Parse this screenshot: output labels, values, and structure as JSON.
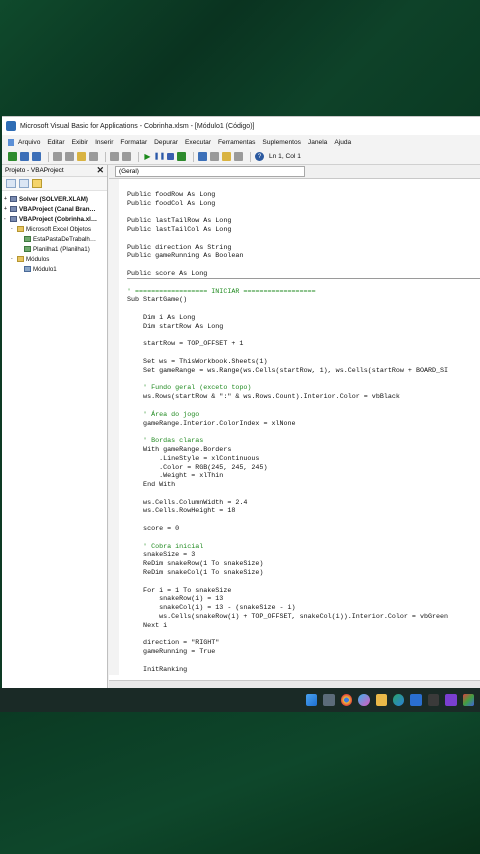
{
  "window": {
    "title": "Microsoft Visual Basic for Applications - Cobrinha.xlsm - [Módulo1 (Código)]"
  },
  "menu": [
    "Arquivo",
    "Editar",
    "Exibir",
    "Inserir",
    "Formatar",
    "Depurar",
    "Executar",
    "Ferramentas",
    "Suplementos",
    "Janela",
    "Ajuda"
  ],
  "toolbar": {
    "position": "Ln 1, Col 1"
  },
  "project_pane": {
    "title": "Projeto - VBAProject",
    "close_glyph": "✕",
    "tree": [
      {
        "label": "Solver (SOLVER.XLAM)",
        "level": 0,
        "icon": "proj",
        "bold": true,
        "twisty": "+"
      },
      {
        "label": "VBAProject (Canal Bran…",
        "level": 0,
        "icon": "proj",
        "bold": true,
        "twisty": "+"
      },
      {
        "label": "VBAProject (Cobrinha.xl…",
        "level": 0,
        "icon": "proj",
        "bold": true,
        "twisty": "-"
      },
      {
        "label": "Microsoft Excel Objetos",
        "level": 1,
        "icon": "folder",
        "bold": false,
        "twisty": "-"
      },
      {
        "label": "EstaPastaDeTrabalh…",
        "level": 2,
        "icon": "sheet",
        "bold": false,
        "twisty": ""
      },
      {
        "label": "Planilha1 (Planilha1)",
        "level": 2,
        "icon": "sheet",
        "bold": false,
        "twisty": ""
      },
      {
        "label": "Módulos",
        "level": 1,
        "icon": "folder",
        "bold": false,
        "twisty": "-"
      },
      {
        "label": "Módulo1",
        "level": 2,
        "icon": "module",
        "bold": false,
        "twisty": ""
      }
    ]
  },
  "code_pane": {
    "object_combo": "(Geral)",
    "lines": [
      {
        "t": "",
        "k": ""
      },
      {
        "t": "Public foodRow As Long",
        "k": ""
      },
      {
        "t": "Public foodCol As Long",
        "k": ""
      },
      {
        "t": "",
        "k": ""
      },
      {
        "t": "Public lastTailRow As Long",
        "k": ""
      },
      {
        "t": "Public lastTailCol As Long",
        "k": ""
      },
      {
        "t": "",
        "k": ""
      },
      {
        "t": "Public direction As String",
        "k": ""
      },
      {
        "t": "Public gameRunning As Boolean",
        "k": ""
      },
      {
        "t": "",
        "k": ""
      },
      {
        "t": "Public score As Long",
        "k": "sep"
      },
      {
        "t": "",
        "k": ""
      },
      {
        "t": "' ================== INICIAR ==================",
        "k": "c"
      },
      {
        "t": "Sub StartGame()",
        "k": ""
      },
      {
        "t": "",
        "k": ""
      },
      {
        "t": "    Dim i As Long",
        "k": ""
      },
      {
        "t": "    Dim startRow As Long",
        "k": ""
      },
      {
        "t": "",
        "k": ""
      },
      {
        "t": "    startRow = TOP_OFFSET + 1",
        "k": ""
      },
      {
        "t": "",
        "k": ""
      },
      {
        "t": "    Set ws = ThisWorkbook.Sheets(1)",
        "k": ""
      },
      {
        "t": "    Set gameRange = ws.Range(ws.Cells(startRow, 1), ws.Cells(startRow + BOARD_SI",
        "k": ""
      },
      {
        "t": "",
        "k": ""
      },
      {
        "t": "    ' Fundo geral (exceto topo)",
        "k": "c"
      },
      {
        "t": "    ws.Rows(startRow & \":\" & ws.Rows.Count).Interior.Color = vbBlack",
        "k": ""
      },
      {
        "t": "",
        "k": ""
      },
      {
        "t": "    ' Área do jogo",
        "k": "c"
      },
      {
        "t": "    gameRange.Interior.ColorIndex = xlNone",
        "k": ""
      },
      {
        "t": "",
        "k": ""
      },
      {
        "t": "    ' Bordas claras",
        "k": "c"
      },
      {
        "t": "    With gameRange.Borders",
        "k": ""
      },
      {
        "t": "        .LineStyle = xlContinuous",
        "k": ""
      },
      {
        "t": "        .Color = RGB(245, 245, 245)",
        "k": ""
      },
      {
        "t": "        .Weight = xlThin",
        "k": ""
      },
      {
        "t": "    End With",
        "k": ""
      },
      {
        "t": "",
        "k": ""
      },
      {
        "t": "    ws.Cells.ColumnWidth = 2.4",
        "k": ""
      },
      {
        "t": "    ws.Cells.RowHeight = 18",
        "k": ""
      },
      {
        "t": "",
        "k": ""
      },
      {
        "t": "    score = 0",
        "k": ""
      },
      {
        "t": "",
        "k": ""
      },
      {
        "t": "    ' Cobra inicial",
        "k": "c"
      },
      {
        "t": "    snakeSize = 3",
        "k": ""
      },
      {
        "t": "    ReDim snakeRow(1 To snakeSize)",
        "k": ""
      },
      {
        "t": "    ReDim snakeCol(1 To snakeSize)",
        "k": ""
      },
      {
        "t": "",
        "k": ""
      },
      {
        "t": "    For i = 1 To snakeSize",
        "k": ""
      },
      {
        "t": "        snakeRow(i) = 13",
        "k": ""
      },
      {
        "t": "        snakeCol(i) = 13 - (snakeSize - i)",
        "k": ""
      },
      {
        "t": "        ws.Cells(snakeRow(i) + TOP_OFFSET, snakeCol(i)).Interior.Color = vbGreen",
        "k": ""
      },
      {
        "t": "    Next i",
        "k": ""
      },
      {
        "t": "",
        "k": ""
      },
      {
        "t": "    direction = \"RIGHT\"",
        "k": ""
      },
      {
        "t": "    gameRunning = True",
        "k": ""
      },
      {
        "t": "",
        "k": ""
      },
      {
        "t": "    InitRanking",
        "k": ""
      }
    ]
  },
  "taskbar": {
    "icons": [
      "windows-start",
      "file-manager",
      "chrome",
      "copilot",
      "file-explorer",
      "edge",
      "mail",
      "terminal",
      "purple-app",
      "multi-app"
    ]
  },
  "colors": {
    "background": "#0d3a24",
    "comment": "#1f8a1f",
    "taskbar": "#1a2a26"
  }
}
